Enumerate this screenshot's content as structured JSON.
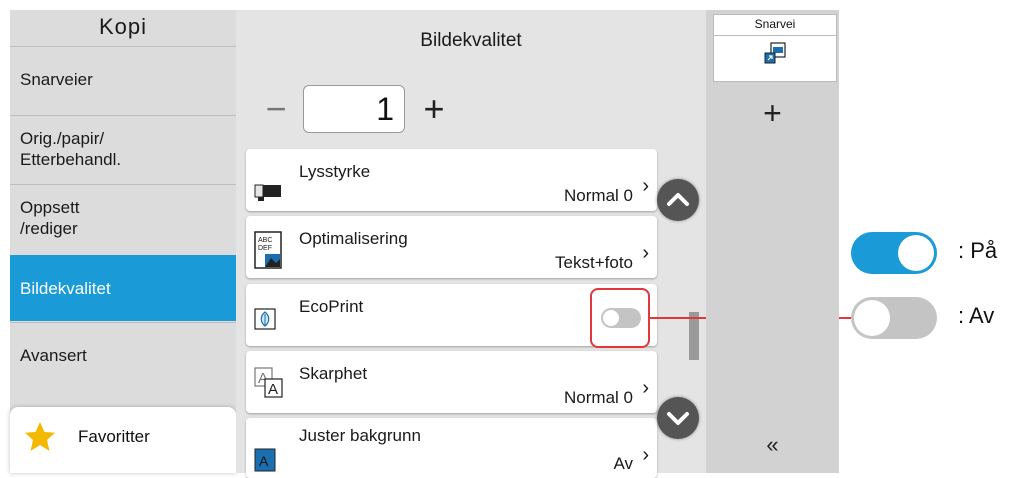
{
  "sidebar": {
    "title": "Kopi",
    "items": [
      {
        "label": "Snarveier",
        "selected": false
      },
      {
        "label": "Orig./papir/\nEtterbehandl.",
        "selected": false
      },
      {
        "label": "Oppsett\n/rediger",
        "selected": false
      },
      {
        "label": "Bildekvalitet",
        "selected": true
      },
      {
        "label": "Avansert",
        "selected": false
      }
    ],
    "favorites_label": "Favoritter"
  },
  "main": {
    "title": "Bildekvalitet",
    "quantity": "1",
    "settings": [
      {
        "name": "Lysstyrke",
        "value": "Normal 0",
        "icon": "brightness-icon"
      },
      {
        "name": "Optimalisering",
        "value": "Tekst+foto",
        "icon": "optimization-icon"
      },
      {
        "name": "EcoPrint",
        "value": "",
        "icon": "ecoprint-icon",
        "toggle": "off"
      },
      {
        "name": "Skarphet",
        "value": "Normal 0",
        "icon": "sharpness-icon"
      },
      {
        "name": "Juster bakgrunn",
        "value": "Av",
        "icon": "background-icon"
      }
    ]
  },
  "right_panel": {
    "shortcut_label": "Snarvei"
  },
  "legend": {
    "on_label": ": På",
    "off_label": ": Av"
  },
  "colors": {
    "accent": "#1a9bd7",
    "highlight_border": "#e0373c",
    "toggle_off": "#c4c4c4",
    "scroll_button": "#555555"
  }
}
